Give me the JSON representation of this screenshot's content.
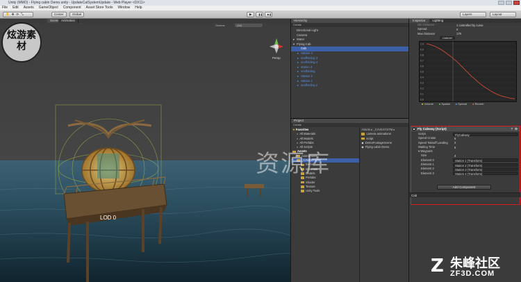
{
  "window": {
    "title": "Unity (MMO) - Flying cabin Demo.unity - UpdateCalSystemUpdate - Web Player <DX11>"
  },
  "menu": [
    "File",
    "Edit",
    "Assets",
    "GameObject",
    "Component",
    "Asset Store Tools",
    "Window",
    "Help"
  ],
  "toolbar": {
    "pivot": "Center",
    "space": "Global",
    "play_icon": "▶",
    "pause_icon": "❚❚",
    "step_icon": "▶❚",
    "layers": "Layers",
    "layout": "Layout"
  },
  "scene": {
    "tabs": [
      "Scene",
      "Animation"
    ],
    "gizmos": "Gizmos",
    "search": "(All)",
    "persp": "Persp",
    "lod": "LOD 0"
  },
  "hierarchy": {
    "title": "Hierarchy",
    "create": "Create",
    "items": [
      {
        "label": "Directional Light",
        "indent": 0,
        "arrow": "",
        "style": ""
      },
      {
        "label": "Camera",
        "indent": 0,
        "arrow": "",
        "style": ""
      },
      {
        "label": "Water",
        "indent": 0,
        "arrow": "▸",
        "style": ""
      },
      {
        "label": "Flying Cab",
        "indent": 0,
        "arrow": "▾",
        "style": ""
      },
      {
        "label": "Cab",
        "indent": 1,
        "arrow": "",
        "style": "sel"
      },
      {
        "label": "Station 3",
        "indent": 1,
        "arrow": "▸",
        "style": "blue"
      },
      {
        "label": "scaffolding 3",
        "indent": 1,
        "arrow": "▸",
        "style": "blue"
      },
      {
        "label": "scaffolding 4",
        "indent": 1,
        "arrow": "▸",
        "style": "blue"
      },
      {
        "label": "station 4",
        "indent": 1,
        "arrow": "▸",
        "style": "blue"
      },
      {
        "label": "scaffolding",
        "indent": 1,
        "arrow": "▸",
        "style": "blue"
      },
      {
        "label": "Station 2",
        "indent": 1,
        "arrow": "▸",
        "style": "blue"
      },
      {
        "label": "Station 1",
        "indent": 1,
        "arrow": "▸",
        "style": "blue"
      },
      {
        "label": "scaffolding 2",
        "indent": 1,
        "arrow": "▸",
        "style": "blue"
      }
    ]
  },
  "project": {
    "title": "Project",
    "create": "Create",
    "breadcrumb": "Assets ▸ _CAVESYSTM ▸",
    "favorites_label": "Favorites",
    "left": [
      {
        "label": "All Materials",
        "indent": 1,
        "icon": "search",
        "style": ""
      },
      {
        "label": "All Models",
        "indent": 1,
        "icon": "search",
        "style": ""
      },
      {
        "label": "All Prefabs",
        "indent": 1,
        "icon": "search",
        "style": ""
      },
      {
        "label": "All Scripts",
        "indent": 1,
        "icon": "search",
        "style": ""
      },
      {
        "label": "Assets",
        "indent": 0,
        "icon": "folder",
        "style": "bold"
      },
      {
        "label": "AnimSheets",
        "indent": 1,
        "icon": "folder",
        "style": ""
      },
      {
        "label": "_CAVESYSTM",
        "indent": 1,
        "icon": "folder",
        "style": "sel"
      },
      {
        "label": "Demo",
        "indent": 2,
        "icon": "folder",
        "style": ""
      },
      {
        "label": "Materials",
        "indent": 2,
        "icon": "folder",
        "style": ""
      },
      {
        "label": "Models",
        "indent": 2,
        "icon": "folder",
        "style": ""
      },
      {
        "label": "Prefabs",
        "indent": 2,
        "icon": "folder",
        "style": ""
      },
      {
        "label": "Shader",
        "indent": 2,
        "icon": "folder",
        "style": ""
      },
      {
        "label": "Texture",
        "indent": 2,
        "icon": "folder",
        "style": ""
      },
      {
        "label": "Unity Tools",
        "indent": 2,
        "icon": "folder",
        "style": ""
      }
    ],
    "right": [
      {
        "label": "camera animations",
        "icon": "folder"
      },
      {
        "label": "script",
        "icon": "folder"
      },
      {
        "label": "DemoFootageScene",
        "icon": "scene"
      },
      {
        "label": "Flying cabin Demo",
        "icon": "scene"
      }
    ]
  },
  "inspector": {
    "tabs": [
      "Inspector",
      "Lighting"
    ],
    "header_rows": [
      {
        "label": "Min Distance",
        "value": "1 controlled by curve",
        "dim": true
      },
      {
        "label": "Spread",
        "value": "0",
        "dim": false
      },
      {
        "label": "Max Distance",
        "value": "170",
        "dim": false
      }
    ],
    "listener_label": "Listener",
    "graph_ticks": [
      "1.0",
      "0.9",
      "0.8",
      "0.7",
      "0.6",
      "0.5",
      "0.4",
      "0.3",
      "0.2",
      "0.1",
      "0.0"
    ],
    "curve": {
      "x": [
        0,
        0.05,
        0.1,
        0.15,
        0.2,
        0.25,
        0.3,
        0.35,
        0.4,
        0.45,
        0.5,
        0.55,
        0.6,
        0.65,
        0.7,
        0.75,
        0.8,
        0.85,
        0.9,
        0.95,
        1
      ],
      "y": [
        1,
        0.98,
        0.95,
        0.91,
        0.86,
        0.8,
        0.74,
        0.67,
        0.59,
        0.51,
        0.43,
        0.36,
        0.29,
        0.23,
        0.18,
        0.13,
        0.09,
        0.06,
        0.04,
        0.02,
        0.01
      ]
    },
    "legend": [
      "Volume",
      "Spatial",
      "Spread",
      "Reverb"
    ],
    "component": {
      "title": "Fly Cabway (Script)",
      "rows": [
        {
          "label": "Script",
          "value": "FlyCabway",
          "type": "box"
        },
        {
          "label": "Speed Cruise",
          "value": "6",
          "type": "plain"
        },
        {
          "label": "Speed Takeoff Landing",
          "value": "2",
          "type": "plain"
        },
        {
          "label": "Waiting Time",
          "value": "5",
          "type": "plain"
        },
        {
          "label": "▾ Waypoint",
          "value": "",
          "type": "none"
        },
        {
          "label": "Size",
          "value": "4",
          "type": "plain"
        },
        {
          "label": "Element 0",
          "value": "Station 1 (Transform)",
          "type": "box"
        },
        {
          "label": "Element 1",
          "value": "Station 2 (Transform)",
          "type": "box"
        },
        {
          "label": "Element 2",
          "value": "Station 3 (Transform)",
          "type": "box"
        },
        {
          "label": "Element 3",
          "value": "Station 4 (Transform)",
          "type": "box"
        }
      ]
    },
    "add_component": "Add Component",
    "footer": "Cab"
  },
  "watermarks": {
    "top_left": "炫游素材",
    "center": "资源库",
    "brand_cn": "朱峰社区",
    "brand_en": "ZF3D.COM",
    "brand_logo": "Z"
  },
  "colors": {
    "selection": "#3d5fa8",
    "highlight_border": "#d21e1e",
    "prefab_blue": "#5c8fe0",
    "curve_red": "#d04d3a"
  }
}
